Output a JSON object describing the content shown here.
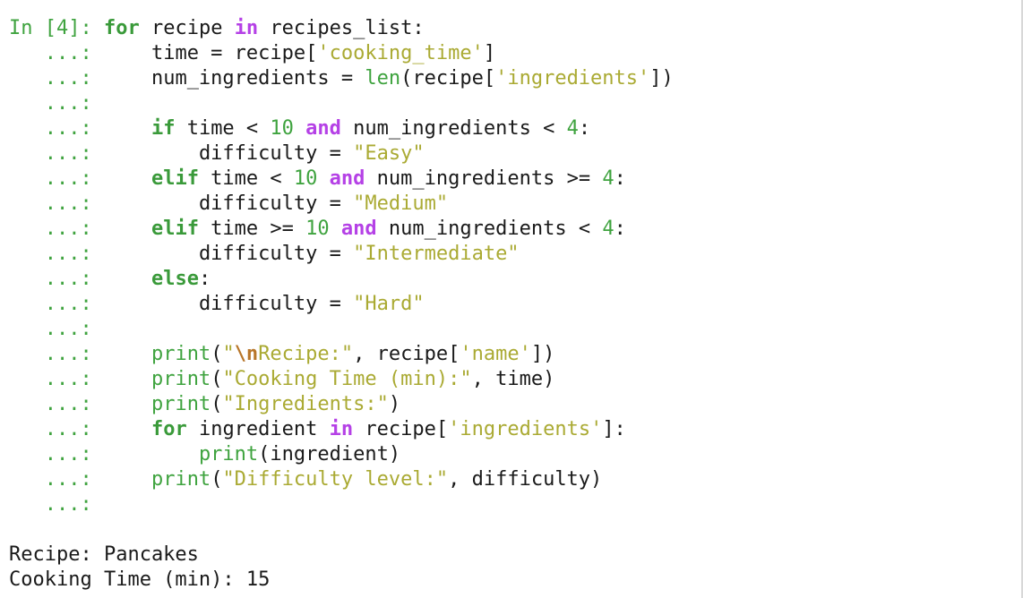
{
  "terminal": {
    "prompt_in": "In [4]: ",
    "prompt_cont": "   ...: ",
    "indent1": "    ",
    "indent2": "        ",
    "code": {
      "l1": {
        "for": "for",
        "t1": " recipe ",
        "in": "in",
        "t2": " recipes_list:"
      },
      "l2": {
        "t1": "time = recipe[",
        "s1": "'cooking_time'",
        "t2": "]"
      },
      "l3": {
        "t1": "num_ingredients = ",
        "b1": "len",
        "t2": "(recipe[",
        "s1": "'ingredients'",
        "t3": "])"
      },
      "l5": {
        "kw": "if",
        "t1": " time < ",
        "n1": "10",
        "t2": " ",
        "op": "and",
        "t3": " num_ingredients < ",
        "n2": "4",
        "t4": ":"
      },
      "l6": {
        "t1": "difficulty = ",
        "s1": "\"Easy\""
      },
      "l7": {
        "kw": "elif",
        "t1": " time < ",
        "n1": "10",
        "t2": " ",
        "op": "and",
        "t3": " num_ingredients >= ",
        "n2": "4",
        "t4": ":"
      },
      "l8": {
        "t1": "difficulty = ",
        "s1": "\"Medium\""
      },
      "l9": {
        "kw": "elif",
        "t1": " time >= ",
        "n1": "10",
        "t2": " ",
        "op": "and",
        "t3": " num_ingredients < ",
        "n2": "4",
        "t4": ":"
      },
      "l10": {
        "t1": "difficulty = ",
        "s1": "\"Intermediate\""
      },
      "l11": {
        "kw": "else",
        "t1": ":"
      },
      "l12": {
        "t1": "difficulty = ",
        "s1": "\"Hard\""
      },
      "l14": {
        "b1": "print",
        "t1": "(",
        "s1": "\"",
        "esc": "\\n",
        "s2": "Recipe:\"",
        "t2": ", recipe[",
        "s3": "'name'",
        "t3": "])"
      },
      "l15": {
        "b1": "print",
        "t1": "(",
        "s1": "\"Cooking Time (min):\"",
        "t2": ", time)"
      },
      "l16": {
        "b1": "print",
        "t1": "(",
        "s1": "\"Ingredients:\"",
        "t2": ")"
      },
      "l17": {
        "kw": "for",
        "t1": " ingredient ",
        "op": "in",
        "t2": " recipe[",
        "s1": "'ingredients'",
        "t3": "]:"
      },
      "l18": {
        "b1": "print",
        "t1": "(ingredient)"
      },
      "l19": {
        "b1": "print",
        "t1": "(",
        "s1": "\"Difficulty level:\"",
        "t2": ", difficulty)"
      }
    },
    "output": {
      "line1": "Recipe: Pancakes",
      "line2": "Cooking Time (min): 15"
    },
    "colors": {
      "prompt": "#3fa33f",
      "keyword": "#3a9a3a",
      "operator": "#b541e6",
      "string": "#aaaa33",
      "escape": "#b8762a"
    }
  }
}
